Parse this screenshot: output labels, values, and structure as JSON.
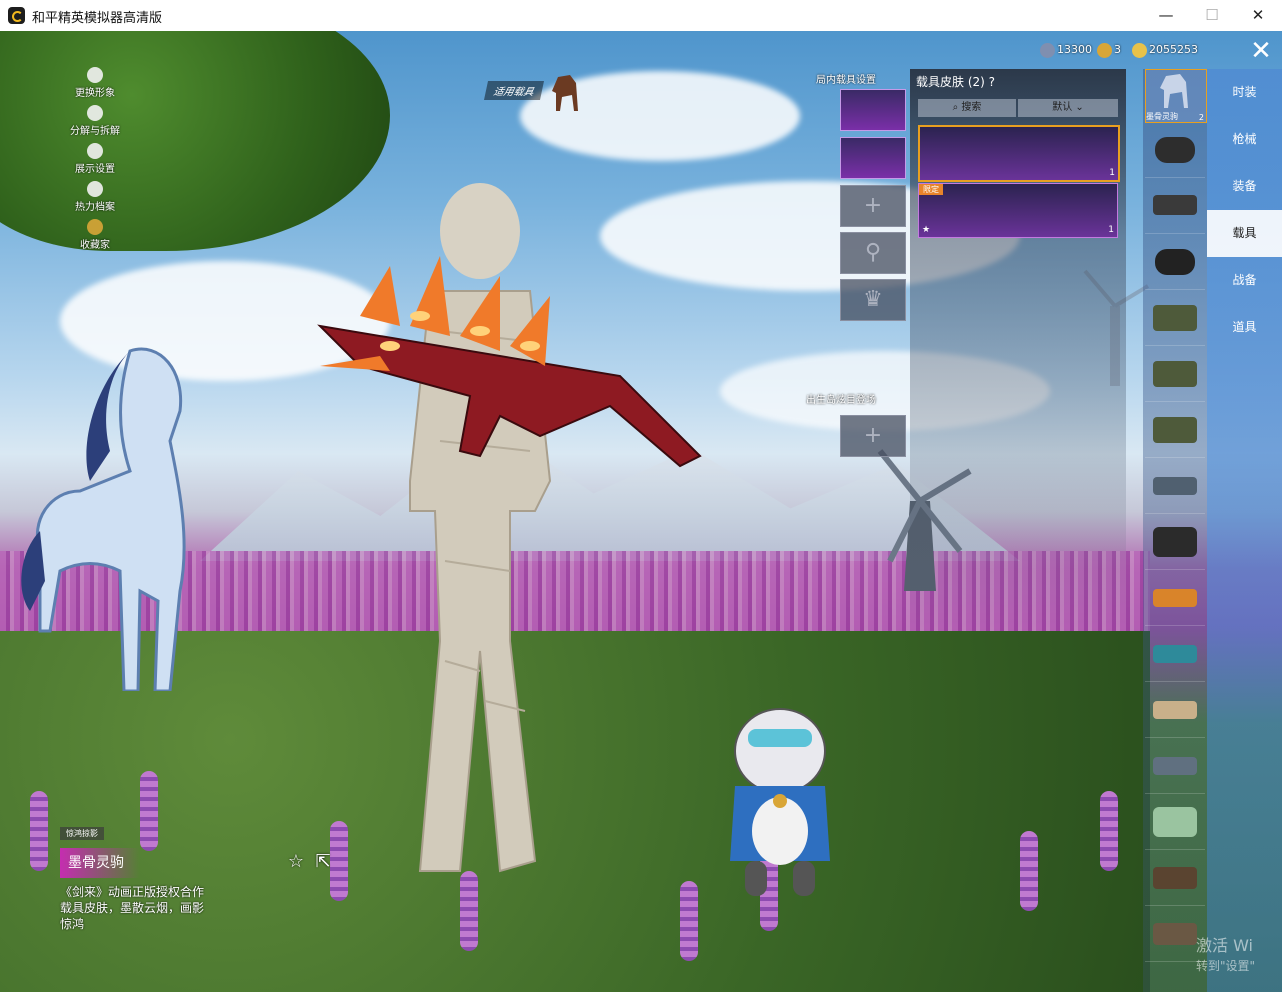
{
  "window": {
    "title": "和平精英模拟器高清版",
    "minimize": "—",
    "maximize": "☐",
    "close": "✕"
  },
  "left_menu": [
    {
      "label": "更换形象",
      "icon": "person-icon"
    },
    {
      "label": "分解与拆解",
      "icon": "puzzle-icon"
    },
    {
      "label": "展示设置",
      "icon": "eye-icon"
    },
    {
      "label": "热力档案",
      "icon": "flame-icon"
    },
    {
      "label": "收藏家",
      "icon": "collector-badge-icon"
    }
  ],
  "vehicle_tag": "适用载具",
  "currency": {
    "silver": "13300",
    "gold": "3",
    "coins": "2055253",
    "colors": {
      "silver": "#7f8fb0",
      "gold": "#d9a637",
      "coins": "#e8c24a"
    }
  },
  "slots": {
    "in_game_title": "局内载具设置",
    "spawn_title": "出生岛炫目登场"
  },
  "skin_panel": {
    "title": "载具皮肤 (2)",
    "help": "?",
    "search_label": "搜索",
    "sort_label": "默认",
    "cards": [
      {
        "tag": "",
        "count": "1",
        "selected": true
      },
      {
        "tag": "限定",
        "count": "1",
        "selected": false
      }
    ]
  },
  "tabs": [
    {
      "label": "时装",
      "active": false
    },
    {
      "label": "枪械",
      "active": false
    },
    {
      "label": "装备",
      "active": false
    },
    {
      "label": "载具",
      "active": true
    },
    {
      "label": "战备",
      "active": false
    },
    {
      "label": "道具",
      "active": false
    }
  ],
  "vehicle_list": {
    "first_label": "墨骨灵驹",
    "first_count": "2",
    "colors": [
      "#2d2d2d",
      "#3a3a3a",
      "#222222",
      "#4e5a3a",
      "#4e5a3a",
      "#4e5a3a",
      "#506070",
      "#2b2b2b",
      "#d9842a",
      "#2e8a9a",
      "#c9b08a",
      "#607080",
      "#9ac4a0",
      "#5a4430",
      "#6a5844"
    ]
  },
  "info": {
    "badge": "惊鸿掠影",
    "name": "墨骨灵驹",
    "description": "《剑来》动画正版授权合作载具皮肤，墨散云烟，画影惊鸿",
    "favorite_icon": "☆",
    "share_icon": "⇱"
  },
  "watermark": {
    "line1": "激活 Wi",
    "line2": "转到\"设置\""
  }
}
